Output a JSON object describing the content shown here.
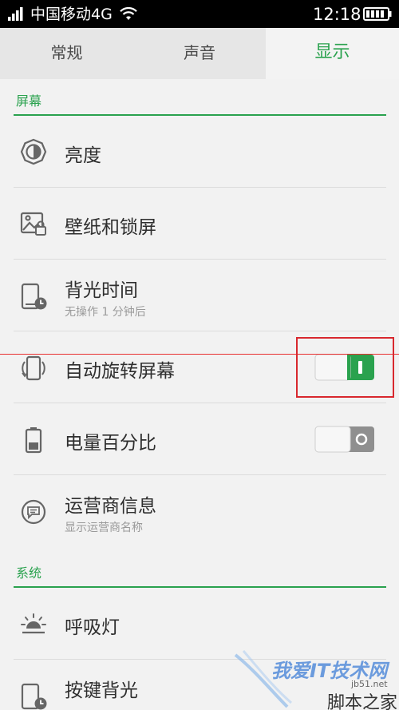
{
  "status_bar": {
    "carrier": "中国移动4G",
    "time": "12:18"
  },
  "tabs": [
    {
      "label": "常规",
      "selected": false
    },
    {
      "label": "声音",
      "selected": false
    },
    {
      "label": "显示",
      "selected": true
    }
  ],
  "sections": {
    "screen": "屏幕",
    "system": "系统"
  },
  "items": [
    {
      "title": "亮度",
      "subtitle": "",
      "icon": "brightness-icon"
    },
    {
      "title": "壁纸和锁屏",
      "subtitle": "",
      "icon": "wallpaper-lock-icon"
    },
    {
      "title": "背光时间",
      "subtitle": "无操作 1 分钟后",
      "icon": "screen-timeout-icon"
    },
    {
      "title": "自动旋转屏幕",
      "subtitle": "",
      "icon": "auto-rotate-icon",
      "toggle": true
    },
    {
      "title": "电量百分比",
      "subtitle": "",
      "icon": "battery-percent-icon",
      "toggle": false
    },
    {
      "title": "运营商信息",
      "subtitle": "显示运营商名称",
      "icon": "carrier-info-icon"
    },
    {
      "title": "呼吸灯",
      "subtitle": "",
      "icon": "breathing-light-icon"
    },
    {
      "title": "按键背光",
      "subtitle": "",
      "icon": "key-backlight-icon"
    }
  ],
  "colors": {
    "accent": "#2aa24e",
    "annotation": "#d8282e"
  },
  "watermark": {
    "text": "我爱IT技术网",
    "url": "jb51.net",
    "script": "脚本之家"
  }
}
